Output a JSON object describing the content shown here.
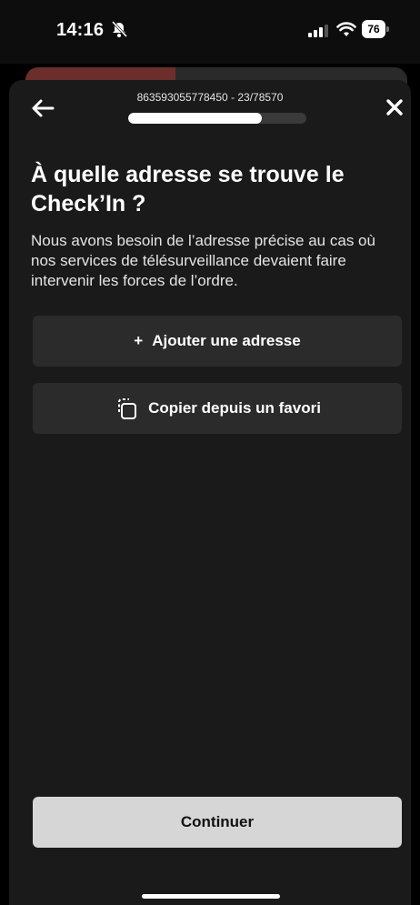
{
  "status_bar": {
    "time": "14:16",
    "battery": "76",
    "icons": [
      "bell-slash-icon",
      "signal-icon",
      "wifi-icon",
      "battery-icon"
    ]
  },
  "header": {
    "code": "863593055778450 - 23/78570",
    "progress": 0.75,
    "back_icon": "arrow-left-icon",
    "close_icon": "close-icon"
  },
  "content": {
    "title": "À quelle adresse se trouve le Check’In ?",
    "description": "Nous avons besoin de l’adresse précise au cas où nos services de télésurveillance devaient faire intervenir les forces de l’ordre."
  },
  "actions": {
    "add_icon": "+",
    "add_address": "Ajouter une adresse",
    "copy_icon": "copy-icon",
    "copy_favorite": "Copier depuis un favori",
    "continue": "Continuer"
  },
  "colors": {
    "background": "#000000",
    "sheet": "#1a1a1a",
    "button": "#2b2b2b",
    "primary_button": "#d6d6d6",
    "accent": "#6b2e2a"
  }
}
